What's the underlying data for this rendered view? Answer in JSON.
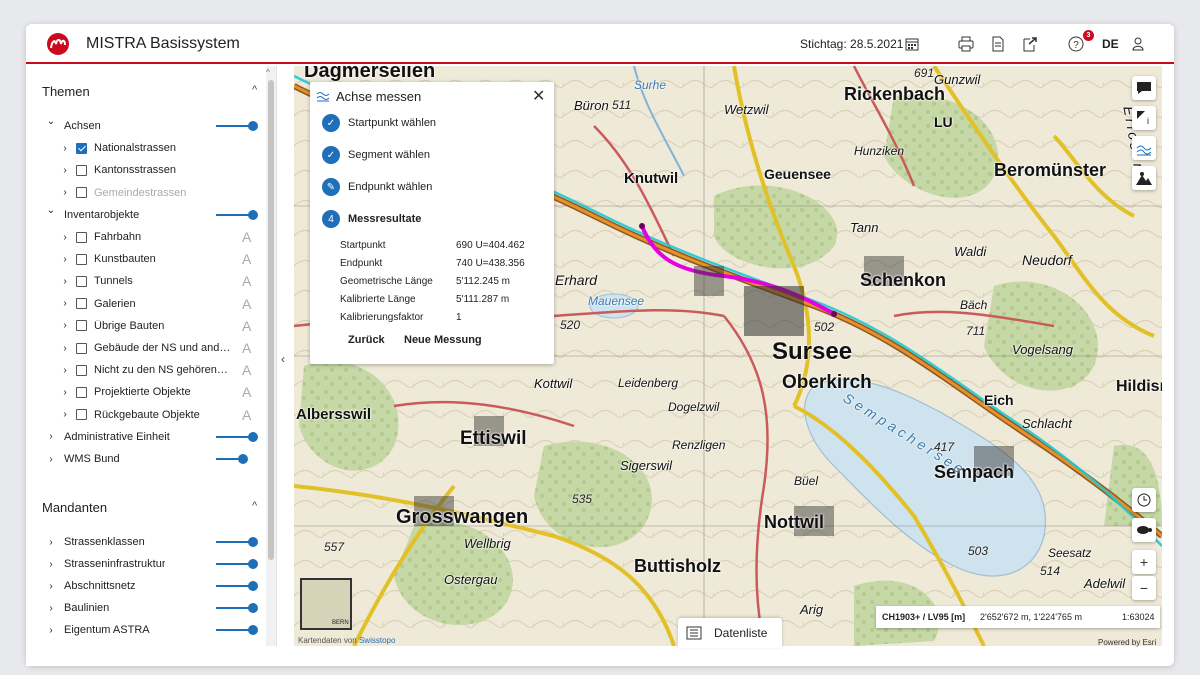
{
  "header": {
    "title": "MISTRA Basissystem",
    "stichtag_label": "Stichtag:",
    "stichtag_date": "28.5.2021",
    "help_badge": "3",
    "language": "DE"
  },
  "sidebar": {
    "themen_title": "Themen",
    "mandanten_title": "Mandanten",
    "themen_items": [
      {
        "label": "Achsen",
        "expanded": true,
        "level": 0
      },
      {
        "label": "Nationalstrassen",
        "checked": true,
        "level": 1
      },
      {
        "label": "Kantonsstrassen",
        "checked": false,
        "level": 1
      },
      {
        "label": "Gemeindestrassen",
        "checked": false,
        "level": 1,
        "disabled": true
      },
      {
        "label": "Inventarobjekte",
        "expanded": true,
        "level": 0
      },
      {
        "label": "Fahrbahn",
        "checked": false,
        "level": 1
      },
      {
        "label": "Kunstbauten",
        "checked": false,
        "level": 1
      },
      {
        "label": "Tunnels",
        "checked": false,
        "level": 1
      },
      {
        "label": "Galerien",
        "checked": false,
        "level": 1
      },
      {
        "label": "Übrige Bauten",
        "checked": false,
        "level": 1
      },
      {
        "label": "Gebäude der NS und andere ...",
        "checked": false,
        "level": 1
      },
      {
        "label": "Nicht zu den NS gehörende ...",
        "checked": false,
        "level": 1
      },
      {
        "label": "Projektierte Objekte",
        "checked": false,
        "level": 1
      },
      {
        "label": "Rückgebaute Objekte",
        "checked": false,
        "level": 1
      },
      {
        "label": "Administrative Einheit",
        "level": 0
      },
      {
        "label": "WMS Bund",
        "level": 0
      }
    ],
    "mandanten_items": [
      {
        "label": "Strassenklassen"
      },
      {
        "label": "Strasseninfrastruktur"
      },
      {
        "label": "Abschnittsnetz"
      },
      {
        "label": "Baulinien"
      },
      {
        "label": "Eigentum ASTRA"
      }
    ]
  },
  "panel": {
    "title": "Achse messen",
    "steps": [
      {
        "label": "Startpunkt wählen",
        "icon": "check-icon"
      },
      {
        "label": "Segment wählen",
        "icon": "check-icon"
      },
      {
        "label": "Endpunkt wählen",
        "icon": "pencil-icon"
      },
      {
        "label": "Messresultate",
        "number": "4"
      }
    ],
    "results": [
      {
        "key": "Startpunkt",
        "value": "690 U=404.462"
      },
      {
        "key": "Endpunkt",
        "value": "740 U=438.356"
      },
      {
        "key": "Geometrische Länge",
        "value": "5'112.245 m"
      },
      {
        "key": "Kalibrierte Länge",
        "value": "5'111.287 m"
      },
      {
        "key": "Kalibrierungsfaktor",
        "value": "1"
      }
    ],
    "back_label": "Zurück",
    "new_label": "Neue Messung"
  },
  "map": {
    "places": [
      "Dagmersellen",
      "Büron",
      "Rickenbach",
      "Wetzwil",
      "Gunzwil",
      "LU",
      "Knutwil",
      "Geuensee",
      "Beromünster",
      "Hunziken",
      "Tann",
      "Waldi",
      "Neudorf",
      "Schenkon",
      "St. Erhard",
      "Mauensee",
      "Bäch",
      "Sursee",
      "Oberkirch",
      "Vogelsang",
      "Kottwil",
      "Leidenberg",
      "Dogelzwil",
      "Eich",
      "Hildisrieden",
      "Albersswil",
      "Ettiswil",
      "Renzligen",
      "Schlacht",
      "Sempach",
      "Sigerswil",
      "Büel",
      "Grosswangen",
      "Nottwil",
      "Wellbrig",
      "Ostergau",
      "Buttisholz",
      "Seesatz",
      "Adelwil",
      "Arig",
      "Sempachersee",
      "Erlosen",
      "Surhe"
    ],
    "spot_heights": [
      "511",
      "520",
      "502",
      "711",
      "417",
      "535",
      "557",
      "503",
      "514",
      "691"
    ],
    "attribution_prefix": "Kartendaten von",
    "attribution_link": "Swisstopo",
    "esri": "Powered by Esri",
    "minimap_label": "BERN",
    "coord_system": "CH1903+ / LV95 [m]",
    "coordinates": "2'652'672 m, 1'224'765 m",
    "scale": "1:63024",
    "datenliste_label": "Datenliste",
    "measure_color": "#e500e0",
    "accent": "#1f6fb8",
    "brand_red": "#cc0a1f"
  }
}
